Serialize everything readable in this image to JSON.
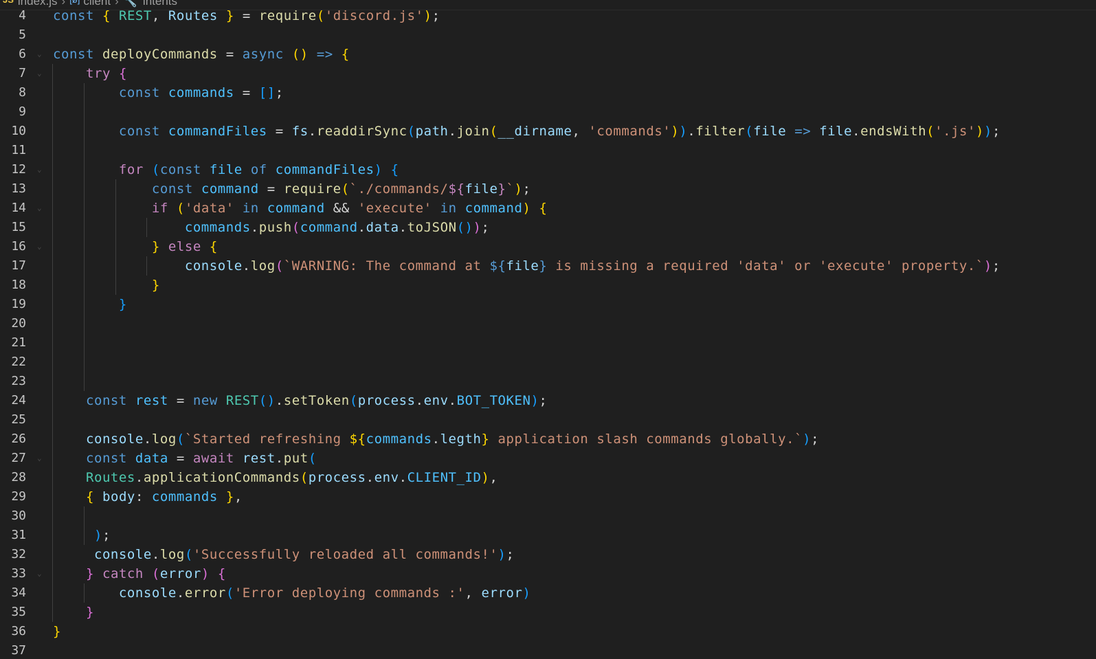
{
  "breadcrumb": {
    "items": [
      "index.js",
      "client",
      "intents"
    ]
  },
  "editor": {
    "language": "javascript",
    "colors": {
      "background": "#1f1f1f",
      "keyword": "#569cd6",
      "control": "#c586c0",
      "variable": "#9cdcfe",
      "constant": "#4fc1ff",
      "class": "#4ec9b0",
      "function": "#dcdcaa",
      "string": "#ce9178",
      "bracket_level_1": "#ffd700",
      "bracket_level_2": "#da70d6",
      "bracket_level_3": "#179fff"
    },
    "lines": [
      {
        "n": "4",
        "fold": false,
        "tokens": [
          [
            "const",
            "kw"
          ],
          [
            " ",
            "plain"
          ],
          [
            "{",
            "br1"
          ],
          [
            " ",
            "plain"
          ],
          [
            "REST",
            "cls"
          ],
          [
            ", ",
            "plain"
          ],
          [
            "Routes",
            "var"
          ],
          [
            " ",
            "plain"
          ],
          [
            "}",
            "br1"
          ],
          [
            " = ",
            "op"
          ],
          [
            "require",
            "fn"
          ],
          [
            "(",
            "br1"
          ],
          [
            "'discord.js'",
            "str"
          ],
          [
            ")",
            "br1"
          ],
          [
            ";",
            "plain"
          ]
        ]
      },
      {
        "n": "5",
        "fold": false,
        "tokens": []
      },
      {
        "n": "6",
        "fold": true,
        "tokens": [
          [
            "const",
            "kw"
          ],
          [
            " ",
            "plain"
          ],
          [
            "deployCommands",
            "fn"
          ],
          [
            " = ",
            "op"
          ],
          [
            "async",
            "kw"
          ],
          [
            " ",
            "plain"
          ],
          [
            "()",
            "br1"
          ],
          [
            " ",
            "plain"
          ],
          [
            "=>",
            "kw"
          ],
          [
            " ",
            "plain"
          ],
          [
            "{",
            "br1"
          ]
        ]
      },
      {
        "n": "7",
        "fold": true,
        "tokens": [
          [
            "    ",
            "plain"
          ],
          [
            "try",
            "ctl"
          ],
          [
            " ",
            "plain"
          ],
          [
            "{",
            "br2"
          ]
        ]
      },
      {
        "n": "8",
        "fold": false,
        "tokens": [
          [
            "        ",
            "plain"
          ],
          [
            "const",
            "kw"
          ],
          [
            " ",
            "plain"
          ],
          [
            "commands",
            "const"
          ],
          [
            " = ",
            "op"
          ],
          [
            "[]",
            "br3"
          ],
          [
            ";",
            "plain"
          ]
        ]
      },
      {
        "n": "9",
        "fold": false,
        "tokens": []
      },
      {
        "n": "10",
        "fold": false,
        "tokens": [
          [
            "        ",
            "plain"
          ],
          [
            "const",
            "kw"
          ],
          [
            " ",
            "plain"
          ],
          [
            "commandFiles",
            "const"
          ],
          [
            " = ",
            "op"
          ],
          [
            "fs",
            "var"
          ],
          [
            ".",
            "plain"
          ],
          [
            "readdirSync",
            "fn"
          ],
          [
            "(",
            "br3"
          ],
          [
            "path",
            "var"
          ],
          [
            ".",
            "plain"
          ],
          [
            "join",
            "fn"
          ],
          [
            "(",
            "br1"
          ],
          [
            "__dirname",
            "var"
          ],
          [
            ", ",
            "plain"
          ],
          [
            "'commands'",
            "str"
          ],
          [
            ")",
            "br1"
          ],
          [
            ")",
            "br3"
          ],
          [
            ".",
            "plain"
          ],
          [
            "filter",
            "fn"
          ],
          [
            "(",
            "br3"
          ],
          [
            "file",
            "var"
          ],
          [
            " ",
            "plain"
          ],
          [
            "=>",
            "kw"
          ],
          [
            " ",
            "plain"
          ],
          [
            "file",
            "var"
          ],
          [
            ".",
            "plain"
          ],
          [
            "endsWith",
            "fn"
          ],
          [
            "(",
            "br1"
          ],
          [
            "'.js'",
            "str"
          ],
          [
            ")",
            "br1"
          ],
          [
            ")",
            "br3"
          ],
          [
            ";",
            "plain"
          ]
        ]
      },
      {
        "n": "11",
        "fold": false,
        "tokens": []
      },
      {
        "n": "12",
        "fold": true,
        "tokens": [
          [
            "        ",
            "plain"
          ],
          [
            "for",
            "ctl"
          ],
          [
            " ",
            "plain"
          ],
          [
            "(",
            "br3"
          ],
          [
            "const",
            "kw"
          ],
          [
            " ",
            "plain"
          ],
          [
            "file",
            "const"
          ],
          [
            " ",
            "plain"
          ],
          [
            "of",
            "kw"
          ],
          [
            " ",
            "plain"
          ],
          [
            "commandFiles",
            "const"
          ],
          [
            ")",
            "br3"
          ],
          [
            " ",
            "plain"
          ],
          [
            "{",
            "br3"
          ]
        ]
      },
      {
        "n": "13",
        "fold": false,
        "tokens": [
          [
            "            ",
            "plain"
          ],
          [
            "const",
            "kw"
          ],
          [
            " ",
            "plain"
          ],
          [
            "command",
            "const"
          ],
          [
            " = ",
            "op"
          ],
          [
            "require",
            "fn"
          ],
          [
            "(",
            "br1"
          ],
          [
            "`./commands/",
            "str"
          ],
          [
            "${",
            "ctl"
          ],
          [
            "file",
            "var"
          ],
          [
            "}",
            "ctl"
          ],
          [
            "`",
            "str"
          ],
          [
            ")",
            "br1"
          ],
          [
            ";",
            "plain"
          ]
        ]
      },
      {
        "n": "14",
        "fold": true,
        "tokens": [
          [
            "            ",
            "plain"
          ],
          [
            "if",
            "ctl"
          ],
          [
            " ",
            "plain"
          ],
          [
            "(",
            "br1"
          ],
          [
            "'data'",
            "str"
          ],
          [
            " ",
            "plain"
          ],
          [
            "in",
            "kw"
          ],
          [
            " ",
            "plain"
          ],
          [
            "command",
            "const"
          ],
          [
            " && ",
            "op"
          ],
          [
            "'execute'",
            "str"
          ],
          [
            " ",
            "plain"
          ],
          [
            "in",
            "kw"
          ],
          [
            " ",
            "plain"
          ],
          [
            "command",
            "const"
          ],
          [
            ")",
            "br1"
          ],
          [
            " ",
            "plain"
          ],
          [
            "{",
            "br1"
          ]
        ]
      },
      {
        "n": "15",
        "fold": false,
        "tokens": [
          [
            "                ",
            "plain"
          ],
          [
            "commands",
            "const"
          ],
          [
            ".",
            "plain"
          ],
          [
            "push",
            "fn"
          ],
          [
            "(",
            "br2"
          ],
          [
            "command",
            "const"
          ],
          [
            ".",
            "plain"
          ],
          [
            "data",
            "var"
          ],
          [
            ".",
            "plain"
          ],
          [
            "toJSON",
            "fn"
          ],
          [
            "()",
            "br3"
          ],
          [
            ")",
            "br2"
          ],
          [
            ";",
            "plain"
          ]
        ]
      },
      {
        "n": "16",
        "fold": true,
        "tokens": [
          [
            "            ",
            "plain"
          ],
          [
            "}",
            "br1"
          ],
          [
            " ",
            "plain"
          ],
          [
            "else",
            "ctl"
          ],
          [
            " ",
            "plain"
          ],
          [
            "{",
            "br1"
          ]
        ]
      },
      {
        "n": "17",
        "fold": false,
        "tokens": [
          [
            "                ",
            "plain"
          ],
          [
            "console",
            "var"
          ],
          [
            ".",
            "plain"
          ],
          [
            "log",
            "fn"
          ],
          [
            "(",
            "br2"
          ],
          [
            "`WARNING: The command at ",
            "str"
          ],
          [
            "${",
            "tpl"
          ],
          [
            "file",
            "var"
          ],
          [
            "}",
            "tpl"
          ],
          [
            " is missing a required 'data' or 'execute' property.`",
            "str"
          ],
          [
            ")",
            "br2"
          ],
          [
            ";",
            "plain"
          ]
        ]
      },
      {
        "n": "18",
        "fold": false,
        "tokens": [
          [
            "            ",
            "plain"
          ],
          [
            "}",
            "br1"
          ]
        ]
      },
      {
        "n": "19",
        "fold": false,
        "tokens": [
          [
            "        ",
            "plain"
          ],
          [
            "}",
            "br3"
          ]
        ]
      },
      {
        "n": "20",
        "fold": false,
        "tokens": []
      },
      {
        "n": "21",
        "fold": false,
        "tokens": []
      },
      {
        "n": "22",
        "fold": false,
        "tokens": []
      },
      {
        "n": "23",
        "fold": false,
        "tokens": []
      },
      {
        "n": "24",
        "fold": false,
        "tokens": [
          [
            "    ",
            "plain"
          ],
          [
            "const",
            "kw"
          ],
          [
            " ",
            "plain"
          ],
          [
            "rest",
            "const"
          ],
          [
            " = ",
            "op"
          ],
          [
            "new",
            "kw"
          ],
          [
            " ",
            "plain"
          ],
          [
            "REST",
            "cls"
          ],
          [
            "()",
            "br3"
          ],
          [
            ".",
            "plain"
          ],
          [
            "setToken",
            "fn"
          ],
          [
            "(",
            "br3"
          ],
          [
            "process",
            "var"
          ],
          [
            ".",
            "plain"
          ],
          [
            "env",
            "var"
          ],
          [
            ".",
            "plain"
          ],
          [
            "BOT_TOKEN",
            "const"
          ],
          [
            ")",
            "br3"
          ],
          [
            ";",
            "plain"
          ]
        ]
      },
      {
        "n": "25",
        "fold": false,
        "tokens": []
      },
      {
        "n": "26",
        "fold": false,
        "tokens": [
          [
            "    ",
            "plain"
          ],
          [
            "console",
            "var"
          ],
          [
            ".",
            "plain"
          ],
          [
            "log",
            "fn"
          ],
          [
            "(",
            "br3"
          ],
          [
            "`Started refreshing ",
            "str"
          ],
          [
            "${",
            "br1"
          ],
          [
            "commands",
            "const"
          ],
          [
            ".",
            "plain"
          ],
          [
            "legth",
            "var"
          ],
          [
            "}",
            "br1"
          ],
          [
            " application slash commands globally.`",
            "str"
          ],
          [
            ")",
            "br3"
          ],
          [
            ";",
            "plain"
          ]
        ]
      },
      {
        "n": "27",
        "fold": true,
        "tokens": [
          [
            "    ",
            "plain"
          ],
          [
            "const",
            "kw"
          ],
          [
            " ",
            "plain"
          ],
          [
            "data",
            "const"
          ],
          [
            " = ",
            "op"
          ],
          [
            "await",
            "ctl"
          ],
          [
            " ",
            "plain"
          ],
          [
            "rest",
            "var"
          ],
          [
            ".",
            "plain"
          ],
          [
            "put",
            "fn"
          ],
          [
            "(",
            "br3"
          ]
        ]
      },
      {
        "n": "28",
        "fold": false,
        "tokens": [
          [
            "    ",
            "plain"
          ],
          [
            "Routes",
            "cls"
          ],
          [
            ".",
            "plain"
          ],
          [
            "applicationCommands",
            "fn"
          ],
          [
            "(",
            "br1"
          ],
          [
            "process",
            "var"
          ],
          [
            ".",
            "plain"
          ],
          [
            "env",
            "var"
          ],
          [
            ".",
            "plain"
          ],
          [
            "CLIENT_ID",
            "const"
          ],
          [
            ")",
            "br1"
          ],
          [
            ",",
            "plain"
          ]
        ]
      },
      {
        "n": "29",
        "fold": false,
        "tokens": [
          [
            "    ",
            "plain"
          ],
          [
            "{",
            "br1"
          ],
          [
            " ",
            "plain"
          ],
          [
            "body",
            "var"
          ],
          [
            ": ",
            "plain"
          ],
          [
            "commands",
            "const"
          ],
          [
            " ",
            "plain"
          ],
          [
            "}",
            "br1"
          ],
          [
            ",",
            "plain"
          ]
        ]
      },
      {
        "n": "30",
        "fold": false,
        "tokens": []
      },
      {
        "n": "31",
        "fold": false,
        "tokens": [
          [
            "     ",
            "plain"
          ],
          [
            ")",
            "br3"
          ],
          [
            ";",
            "plain"
          ]
        ]
      },
      {
        "n": "32",
        "fold": false,
        "tokens": [
          [
            "     ",
            "plain"
          ],
          [
            "console",
            "var"
          ],
          [
            ".",
            "plain"
          ],
          [
            "log",
            "fn"
          ],
          [
            "(",
            "br3"
          ],
          [
            "'Successfully reloaded all commands!'",
            "str"
          ],
          [
            ")",
            "br3"
          ],
          [
            ";",
            "plain"
          ]
        ]
      },
      {
        "n": "33",
        "fold": true,
        "tokens": [
          [
            "    ",
            "plain"
          ],
          [
            "}",
            "br2"
          ],
          [
            " ",
            "plain"
          ],
          [
            "catch",
            "ctl"
          ],
          [
            " ",
            "plain"
          ],
          [
            "(",
            "br2"
          ],
          [
            "error",
            "var"
          ],
          [
            ")",
            "br2"
          ],
          [
            " ",
            "plain"
          ],
          [
            "{",
            "br2"
          ]
        ]
      },
      {
        "n": "34",
        "fold": false,
        "tokens": [
          [
            "        ",
            "plain"
          ],
          [
            "console",
            "var"
          ],
          [
            ".",
            "plain"
          ],
          [
            "error",
            "fn"
          ],
          [
            "(",
            "br3"
          ],
          [
            "'Error deploying commands :'",
            "str"
          ],
          [
            ", ",
            "plain"
          ],
          [
            "error",
            "var"
          ],
          [
            ")",
            "br3"
          ]
        ]
      },
      {
        "n": "35",
        "fold": false,
        "tokens": [
          [
            "    ",
            "plain"
          ],
          [
            "}",
            "br2"
          ]
        ]
      },
      {
        "n": "36",
        "fold": false,
        "tokens": [
          [
            "}",
            "br1"
          ]
        ]
      },
      {
        "n": "37",
        "fold": false,
        "tokens": []
      }
    ]
  }
}
